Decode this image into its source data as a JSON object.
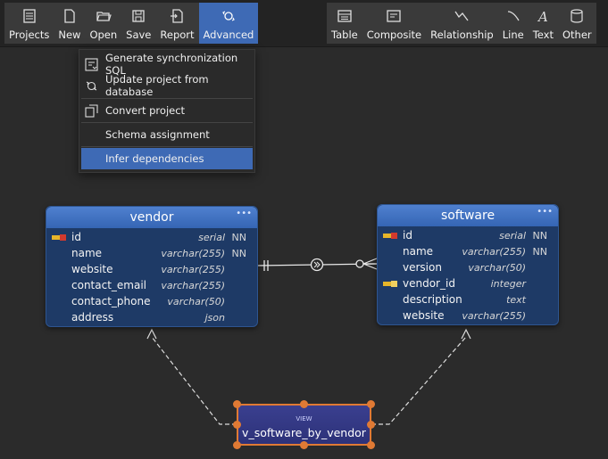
{
  "toolbar": {
    "left": [
      {
        "label": "Projects",
        "icon": "projects-icon"
      },
      {
        "label": "New",
        "icon": "new-file-icon"
      },
      {
        "label": "Open",
        "icon": "open-folder-icon"
      },
      {
        "label": "Save",
        "icon": "save-icon"
      },
      {
        "label": "Report",
        "icon": "report-icon"
      },
      {
        "label": "Advanced",
        "icon": "advanced-icon",
        "active": true
      }
    ],
    "right": [
      {
        "label": "Table",
        "icon": "table-icon"
      },
      {
        "label": "Composite",
        "icon": "composite-icon"
      },
      {
        "label": "Relationship",
        "icon": "relationship-icon"
      },
      {
        "label": "Line",
        "icon": "line-icon"
      },
      {
        "label": "Text",
        "icon": "text-icon"
      },
      {
        "label": "Other",
        "icon": "other-icon"
      }
    ]
  },
  "advanced_menu": {
    "items": [
      {
        "label": "Generate synchronization SQL",
        "icon": "sync-sql-icon"
      },
      {
        "label": "Update project from database",
        "icon": "update-db-icon"
      },
      {
        "label": "Convert project",
        "icon": "convert-icon"
      },
      {
        "label": "Schema assignment"
      },
      {
        "label": "Infer dependencies",
        "highlighted": true
      }
    ]
  },
  "tables": {
    "vendor": {
      "name": "vendor",
      "columns": [
        {
          "name": "id",
          "type": "serial",
          "nn": "NN",
          "key": "primary"
        },
        {
          "name": "name",
          "type": "varchar(255)",
          "nn": "NN"
        },
        {
          "name": "website",
          "type": "varchar(255)",
          "nn": ""
        },
        {
          "name": "contact_email",
          "type": "varchar(255)",
          "nn": ""
        },
        {
          "name": "contact_phone",
          "type": "varchar(50)",
          "nn": ""
        },
        {
          "name": "address",
          "type": "json",
          "nn": ""
        }
      ]
    },
    "software": {
      "name": "software",
      "columns": [
        {
          "name": "id",
          "type": "serial",
          "nn": "NN",
          "key": "primary"
        },
        {
          "name": "name",
          "type": "varchar(255)",
          "nn": "NN"
        },
        {
          "name": "version",
          "type": "varchar(50)",
          "nn": ""
        },
        {
          "name": "vendor_id",
          "type": "integer",
          "nn": "",
          "key": "foreign"
        },
        {
          "name": "description",
          "type": "text",
          "nn": ""
        },
        {
          "name": "website",
          "type": "varchar(255)",
          "nn": ""
        }
      ]
    }
  },
  "view": {
    "tag": "VIEW",
    "name": "v_software_by_vendor"
  },
  "colors": {
    "accent": "#3e6ab5",
    "selection": "#e07a34",
    "table_header": "#3565b4"
  }
}
